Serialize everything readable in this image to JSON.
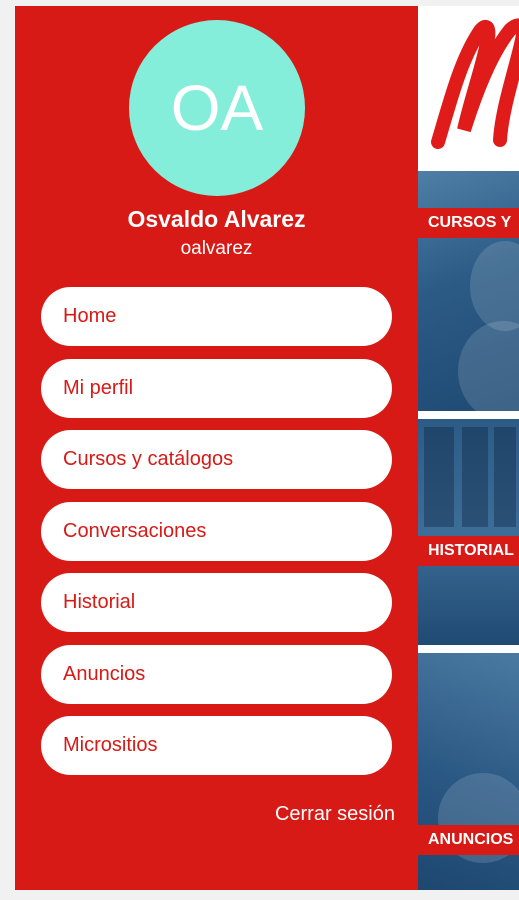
{
  "user": {
    "initials": "OA",
    "name": "Osvaldo Alvarez",
    "username": "oalvarez"
  },
  "menu": [
    {
      "label": "Home"
    },
    {
      "label": "Mi perfil"
    },
    {
      "label": "Cursos y catálogos"
    },
    {
      "label": "Conversaciones"
    },
    {
      "label": "Historial"
    },
    {
      "label": "Anuncios"
    },
    {
      "label": "Micrositios"
    }
  ],
  "logout_label": "Cerrar sesión",
  "background_tiles": [
    {
      "label": "CURSOS Y"
    },
    {
      "label": "HISTORIAL"
    },
    {
      "label": "ANUNCIOS"
    }
  ],
  "colors": {
    "brand_red": "#d71a16",
    "avatar_bg": "#85eedb",
    "tile_blue": "#1f4d73"
  }
}
